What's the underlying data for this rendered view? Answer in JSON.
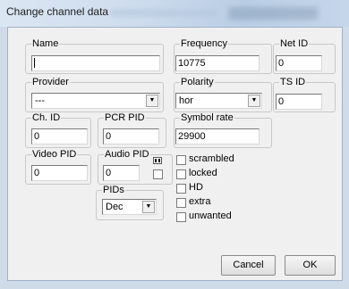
{
  "window": {
    "title": "Change channel data"
  },
  "fields": {
    "name": {
      "label": "Name",
      "value": ""
    },
    "frequency": {
      "label": "Frequency",
      "value": "10775"
    },
    "net_id": {
      "label": "Net ID",
      "value": "0"
    },
    "provider": {
      "label": "Provider",
      "value": "---"
    },
    "polarity": {
      "label": "Polarity",
      "value": "hor"
    },
    "ts_id": {
      "label": "TS ID",
      "value": "0"
    },
    "ch_id": {
      "label": "Ch. ID",
      "value": "0"
    },
    "pcr_pid": {
      "label": "PCR PID",
      "value": "0"
    },
    "symbol_rate": {
      "label": "Symbol rate",
      "value": "29900"
    },
    "video_pid": {
      "label": "Video PID",
      "value": "0"
    },
    "audio_pid": {
      "label": "Audio PID",
      "value": "0"
    },
    "pids": {
      "label": "PIDs",
      "value": "Dec"
    }
  },
  "flags": [
    {
      "label": "scrambled",
      "checked": false
    },
    {
      "label": "locked",
      "checked": false
    },
    {
      "label": "HD",
      "checked": false
    },
    {
      "label": "extra",
      "checked": false
    },
    {
      "label": "unwanted",
      "checked": false
    }
  ],
  "buttons": {
    "cancel": "Cancel",
    "ok": "OK"
  },
  "icons": {
    "dropdown": "chevron-down-icon",
    "audio_toggle": "stereo-icon"
  }
}
